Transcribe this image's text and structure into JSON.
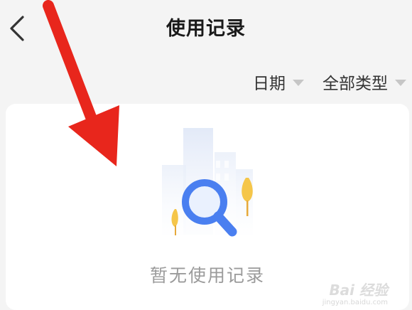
{
  "header": {
    "title": "使用记录",
    "back_icon": "chevron-left-icon"
  },
  "filters": [
    {
      "label": "日期",
      "icon": "caret-down-icon"
    },
    {
      "label": "全部类型",
      "icon": "caret-down-icon"
    }
  ],
  "empty_state": {
    "text": "暂无使用记录",
    "illustration": "magnifier-city-illustration"
  },
  "watermark": {
    "brand": "Bai 经验",
    "url": "jingyan.baidu.com"
  },
  "overlay": {
    "arrow_color": "#e8261c"
  },
  "colors": {
    "background": "#f4f4f4",
    "card": "#ffffff",
    "accent_blue": "#4a7ff0",
    "tree_yellow": "#f5c64a"
  }
}
